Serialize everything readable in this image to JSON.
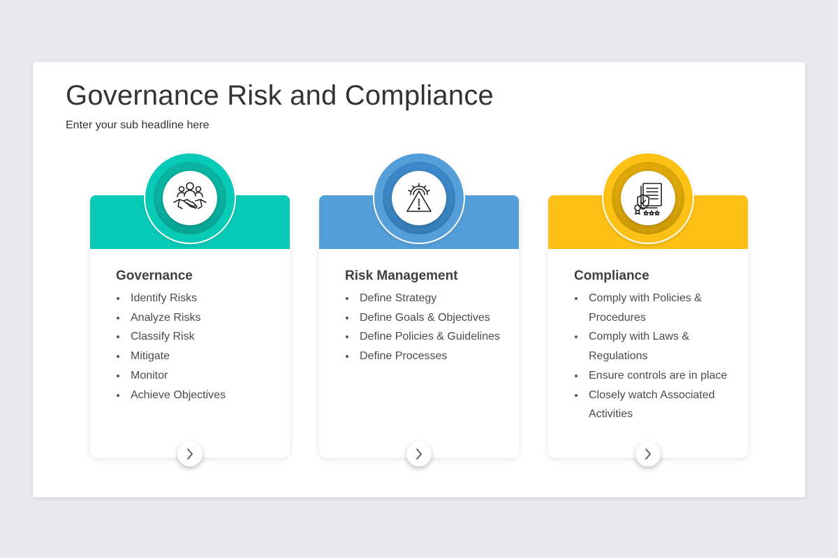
{
  "slide": {
    "title": "Governance Risk and Compliance",
    "subtitle": "Enter your sub headline here"
  },
  "cards": [
    {
      "title": "Governance",
      "color": "#07cbb6",
      "ring_color": "#0ab4a2",
      "icon": "handshake-team-icon",
      "items": [
        "Identify Risks",
        "Analyze Risks",
        "Classify Risk",
        "Mitigate",
        "Monitor",
        "Achieve Objectives"
      ]
    },
    {
      "title": "Risk Management",
      "color": "#549fd9",
      "ring_color": "#3c88c8",
      "icon": "warning-gear-icon",
      "items": [
        "Define Strategy",
        "Define Goals & Objectives",
        "Define Policies & Guidelines",
        "Define Processes"
      ]
    },
    {
      "title": "Compliance",
      "color": "#fcc114",
      "ring_color": "#dea80a",
      "icon": "certificate-document-icon",
      "items": [
        "Comply with Policies & Procedures",
        "Comply with Laws & Regulations",
        "Ensure controls are in place",
        "Closely watch Associated Activities"
      ]
    }
  ],
  "next_button": {
    "icon": "chevron-right-icon"
  }
}
